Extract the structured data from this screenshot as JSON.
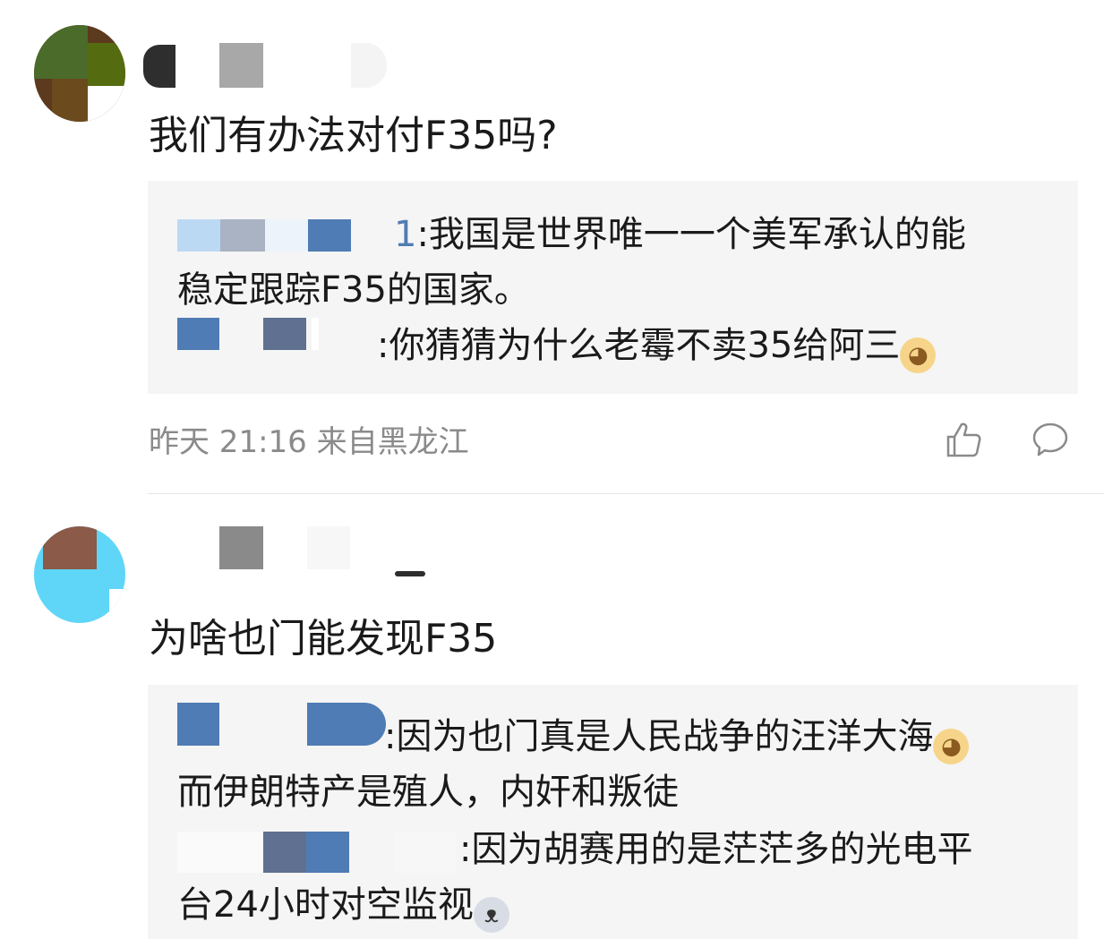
{
  "comments": [
    {
      "text": "我们有办法对付F35吗?",
      "replies": [
        {
          "name_tail": "1",
          "text": ":我国是世界唯一一个美军承认的能",
          "continuation": "稳定跟踪F35的国家。"
        },
        {
          "text": ":你猜猜为什么老霉不卖35给阿三",
          "emoji": "doge-emoji"
        }
      ],
      "time": "昨天 21:16",
      "location": "来自黑龙江",
      "actions": {
        "like_icon": "thumbs-up-icon",
        "reply_icon": "speech-bubble-icon"
      }
    },
    {
      "text": "为啥也门能发现F35",
      "replies": [
        {
          "text": ":因为也门真是人民战争的汪洋大海",
          "emoji": "doge-emoji",
          "continuation": "而伊朗特产是殖人，内奸和叛徒"
        },
        {
          "text": ":因为胡赛用的是茫茫多的光电平",
          "continuation": "台24小时对空监视",
          "emoji": "husky-emoji"
        }
      ]
    }
  ],
  "colors": {
    "reply_bg": "#f5f5f5",
    "meta_text": "#8a8a8a",
    "name_blur": "#4f7cb4"
  }
}
